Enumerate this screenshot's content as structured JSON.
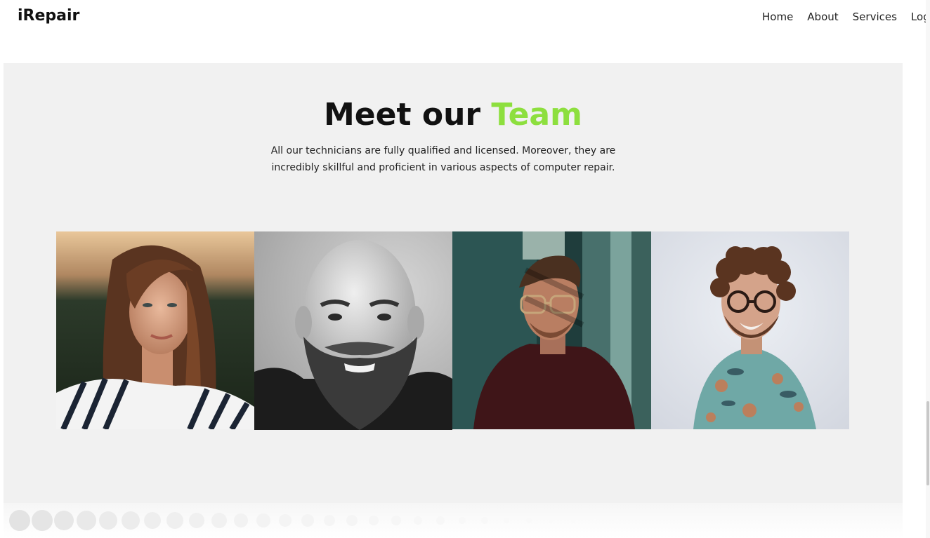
{
  "header": {
    "brand": "iRepair",
    "nav": [
      {
        "label": "Home"
      },
      {
        "label": "About"
      },
      {
        "label": "Services"
      },
      {
        "label": "Log"
      }
    ]
  },
  "team": {
    "title_main": "Meet our ",
    "title_accent": "Team",
    "accent_color": "#8ddf3e",
    "description": "All our technicians are fully qualified and licensed. Moreover, they are incredibly skillful and proficient in various aspects of computer repair.",
    "members": [
      {
        "photo": "woman-long-hair-striped-shirt-photo"
      },
      {
        "photo": "bald-bearded-man-bw-photo"
      },
      {
        "photo": "man-glasses-dark-sweater-photo"
      },
      {
        "photo": "curly-hair-man-floral-shirt-photo"
      }
    ]
  },
  "colors": {
    "section_bg": "#f1f1f1",
    "text": "#111111"
  }
}
